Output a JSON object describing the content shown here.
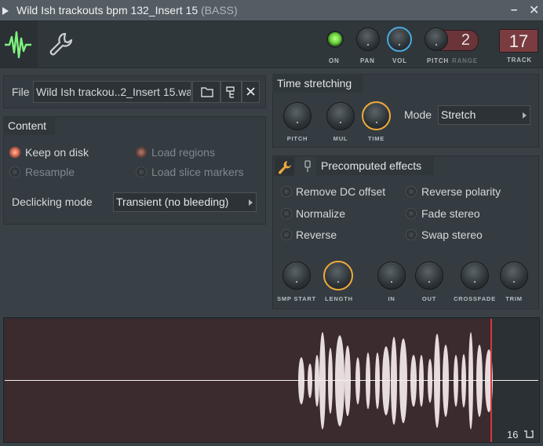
{
  "window": {
    "title": "Wild Ish trackouts bpm 132_Insert 15",
    "subtitle": "(BASS)",
    "minimize": "–",
    "close": "✕"
  },
  "header": {
    "on_label": "ON",
    "pan_label": "PAN",
    "vol_label": "VOL",
    "pitch_label": "PITCH",
    "range_label": "RANGE",
    "range_value": "2",
    "track_label": "TRACK",
    "track_value": "17",
    "icons": [
      "waveform-icon",
      "wrench-icon"
    ]
  },
  "file": {
    "label": "File",
    "value": "Wild Ish trackou..2_Insert 15.wav",
    "buttons": [
      "folder-icon",
      "locate-icon",
      "close-icon"
    ]
  },
  "content": {
    "title": "Content",
    "options": [
      {
        "label": "Keep on disk",
        "state": "on"
      },
      {
        "label": "Load regions",
        "state": "dim-on"
      },
      {
        "label": "Resample",
        "state": "dim-off"
      },
      {
        "label": "Load slice markers",
        "state": "dim-off"
      }
    ],
    "declicking_label": "Declicking mode",
    "declicking_value": "Transient (no bleeding)"
  },
  "time_stretching": {
    "title": "Time stretching",
    "knobs": [
      "PITCH",
      "MUL",
      "TIME"
    ],
    "mode_label": "Mode",
    "mode_value": "Stretch"
  },
  "precomputed": {
    "title": "Precomputed effects",
    "effects_left": [
      "Remove DC offset",
      "Normalize",
      "Reverse"
    ],
    "effects_right": [
      "Reverse polarity",
      "Fade stereo",
      "Swap stereo"
    ],
    "knobs": [
      "SMP START",
      "LENGTH",
      "IN",
      "OUT",
      "CROSSFADE",
      "TRIM"
    ]
  },
  "waveform": {
    "page_number": "16"
  },
  "colors": {
    "accent_orange": "#f0a93b",
    "accent_blue": "#4aa8e0",
    "led_green": "#6bd43a",
    "radio_on": "#e87a5e",
    "cursor_red": "#d43a3a",
    "track_red": "#7a3c40"
  }
}
